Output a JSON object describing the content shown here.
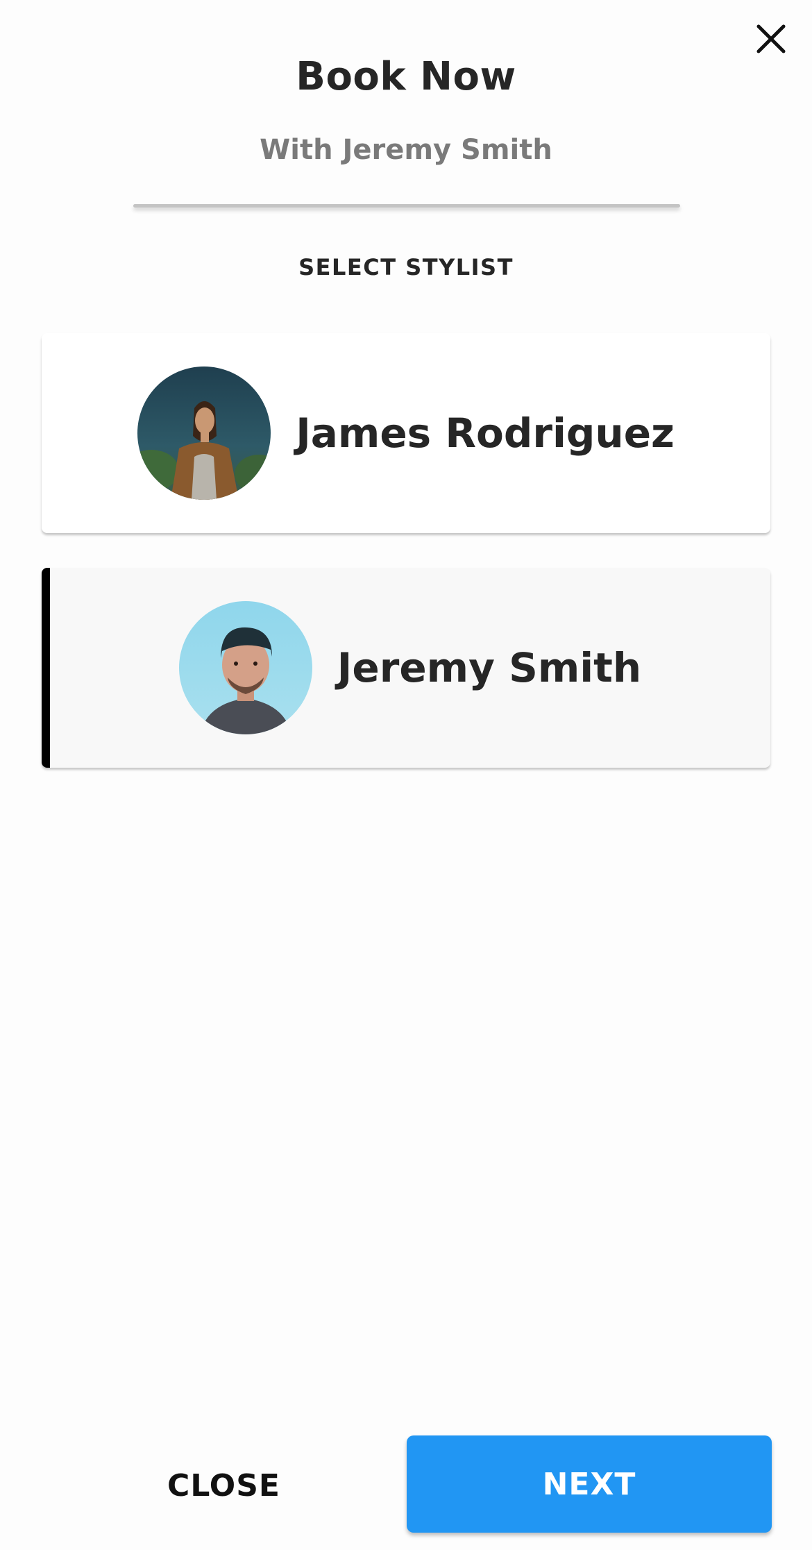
{
  "header": {
    "title": "Book Now",
    "subtitle": "With Jeremy Smith",
    "close_icon": "close-icon"
  },
  "section": {
    "label": "SELECT STYLIST"
  },
  "stylists": [
    {
      "name": "James Rodriguez",
      "avatar": "avatar-photo",
      "selected": false
    },
    {
      "name": "Jeremy Smith",
      "avatar": "avatar-photo",
      "selected": true
    }
  ],
  "footer": {
    "close_label": "CLOSE",
    "next_label": "NEXT"
  },
  "colors": {
    "accent": "#2196f3",
    "selected_indicator": "#000000",
    "title_text": "#262626",
    "subtitle_text": "#7a7a7a"
  }
}
